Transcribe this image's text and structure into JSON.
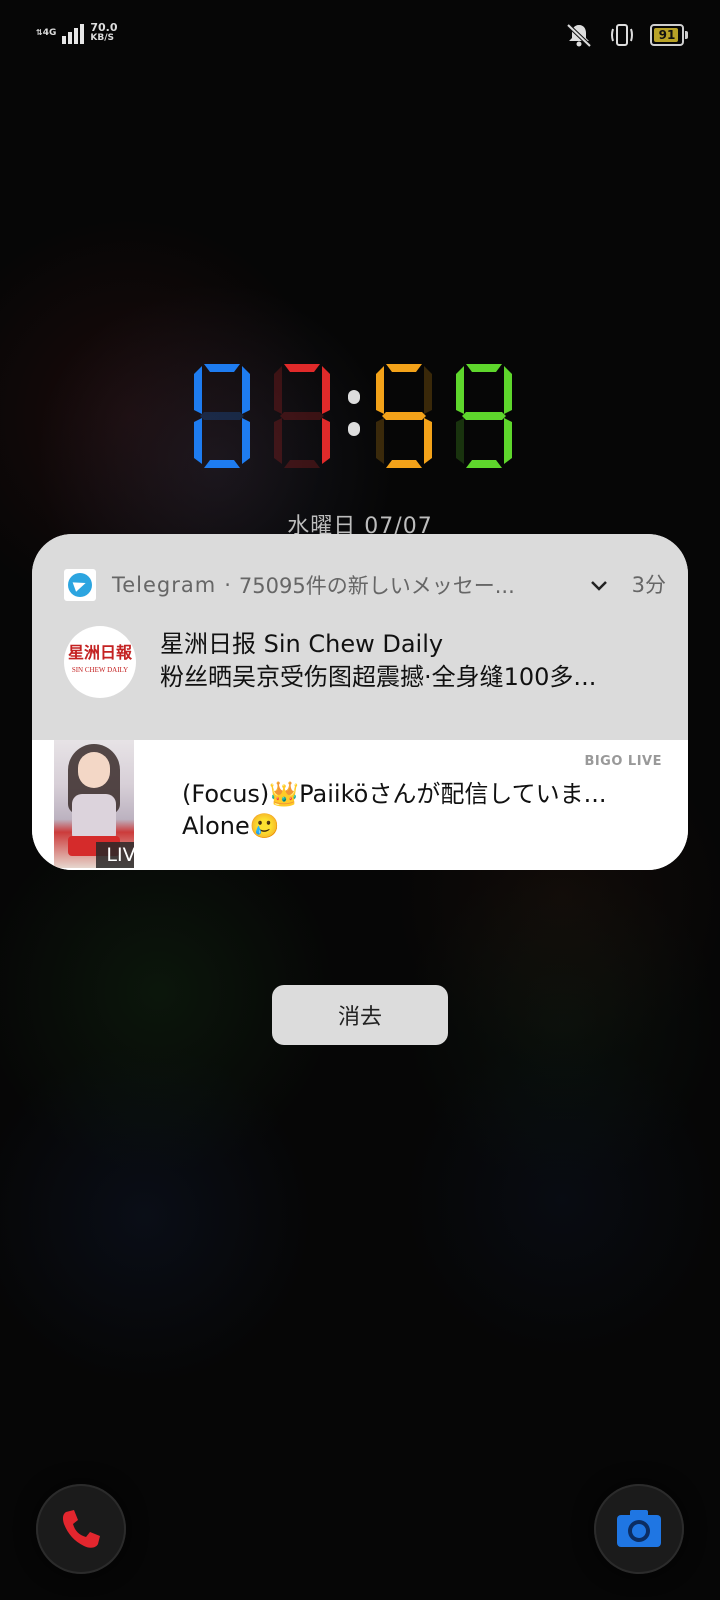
{
  "status_bar": {
    "network_type": "4G",
    "net_speed_value": "70.0",
    "net_speed_unit": "KB/S",
    "battery_level": "91",
    "battery_color": "#b8a227"
  },
  "clock": {
    "hour1": "0",
    "hour2": "7",
    "minute1": "5",
    "minute2": "9",
    "digit_colors": [
      "#1e7cf0",
      "#e02a2a",
      "#f3a219",
      "#5ed62c"
    ],
    "date": "水曜日 07/07"
  },
  "notification": {
    "telegram": {
      "app_name": "Telegram",
      "separator": "·",
      "summary": "75095件の新しいメッセー...",
      "time": "3分",
      "sender": "星洲日报 Sin Chew Daily",
      "message": "粉丝晒吴京受伤图超震撼·全身缝100多...",
      "avatar_logo_cn": "星洲日報",
      "avatar_logo_en": "SIN CHEW DAILY",
      "icon": "telegram-icon",
      "expand_icon": "chevron-down-icon"
    },
    "bigo": {
      "brand": "BIGO LIVE",
      "live_badge": "LIVE",
      "title": "(Focus)👑Paiiköさんが配信していま...",
      "body": "Alone🥲"
    }
  },
  "dismiss_button": {
    "label": "消去"
  },
  "shortcuts": {
    "phone_icon": "phone-icon",
    "camera_icon": "camera-icon",
    "phone_color": "#e3262e",
    "camera_color": "#1f76e3"
  }
}
